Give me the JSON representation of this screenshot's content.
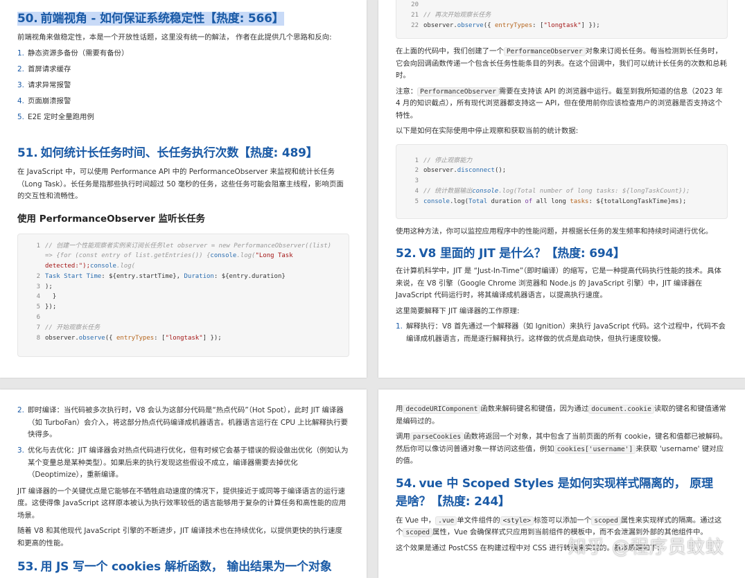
{
  "p1": {
    "q50_num": "50.",
    "q50_title": "前端视角 - 如何保证系统稳定性【热度: 566】",
    "q50_intro": "前端视角来做稳定性，本是一个开放性话题，这里没有统一的解法， 作者在此提供几个思路和反向:",
    "q50_items": [
      "静态资源多备份（需要有备份）",
      "首屏请求缓存",
      "请求异常报警",
      "页面崩溃报警",
      "E2E 定时全量跑用例"
    ],
    "q51_num": "51.",
    "q51_title": "如何统计长任务时间、长任务执行次数【热度: 489】",
    "q51_intro": "在 JavaScript 中，可以使用 Performance API 中的 PerformanceObserver 来监视和统计长任务（Long Task）。长任务是指那些执行时间超过 50 毫秒的任务，这些任务可能会阻塞主线程，影响页面的交互性和流畅性。",
    "q51_sub": "使用 PerformanceObserver 监听长任务",
    "code": {
      "l1a": "// 创建一个性能观察者实例来订阅长任务let observer = new PerformanceObserver((list)",
      "l1b": "=> {for (const entry of list.getEntries()) {",
      "l1b_fn": "console",
      "l1b_rest": ".log(",
      "l1b_str": "\"Long Task",
      "l1c_str": "detected:\");",
      "l1c_fn": "console",
      "l1c_rest": ".log(",
      "l2_a": "Task Start Time",
      "l2_b": ": ${entry.startTime}, ",
      "l2_c": "Duration",
      "l2_d": ": ${entry.duration}",
      "l3": ");",
      "l4": "  }",
      "l5": "});",
      "l6": "",
      "l7": "// 开始观察长任务",
      "l8_a": "observer.",
      "l8_fn": "observe",
      "l8_b": "({ ",
      "l8_key": "entryTypes",
      "l8_c": ": [",
      "l8_str": "\"longtask\"",
      "l8_d": "] });"
    }
  },
  "p2": {
    "code_top": {
      "l20": "",
      "l21": "// 再次开始观察长任务",
      "l22_a": "observer.",
      "l22_fn": "observe",
      "l22_b": "({ ",
      "l22_key": "entryTypes",
      "l22_c": ": [",
      "l22_str": "\"longtask\"",
      "l22_d": "] });"
    },
    "para1_a": "在上面的代码中，我们创建了一个",
    "para1_code": "PerformanceObserver",
    "para1_b": "对象来订阅长任务。每当检测到长任务时，它会向回调函数传递一个包含长任务性能条目的列表。在这个回调中，我们可以统计长任务的次数和总耗时。",
    "para2_a": "注意：",
    "para2_code": "PerformanceObserver",
    "para2_b": "需要在支持该 API 的浏览器中运行。截至到我所知道的信息（2023 年 4 月的知识截点），所有现代浏览器都支持这一 API，但在使用前你应该检查用户的浏览器是否支持这个特性。",
    "para3": "以下是如何在实际使用中停止观察和获取当前的统计数据:",
    "code2": {
      "l1": "// 停止观察能力",
      "l2_a": "observer.",
      "l2_fn": "disconnect",
      "l2_b": "();",
      "l3": "",
      "l4a": "// 统计数据输出",
      "l4b": "console",
      "l4c": ".log(Total number of long tasks: ${longTaskCount});",
      "l5_fn": "console",
      "l5_a": ".log(",
      "l5_b": "Total",
      "l5_c": " duration ",
      "l5_d": "of",
      "l5_e": " all long ",
      "l5_f": "tasks",
      "l5_g": ": ${totalLongTaskTime}ms);"
    },
    "para4": "使用这种方法，你可以监控应用程序中的性能问题，并根据长任务的发生频率和持续时间进行优化。",
    "q52_num": "52.",
    "q52_title": "V8 里面的 JIT 是什么？【热度: 694】",
    "q52_intro": "在计算机科学中，JIT 是 “Just-In-Time”（即时编译）的缩写，它是一种提高代码执行性能的技术。具体来说，在 V8 引擎（Google Chrome 浏览器和 Node.js 的 JavaScript 引擎）中，JIT 编译器在 JavaScript 代码运行时，将其编译成机器语言，以提高执行速度。",
    "q52_p2": "这里简要解释下 JIT 编译器的工作原理:",
    "q52_item1": "解释执行：V8 首先通过一个解释器（如 Ignition）来执行 JavaScript 代码。这个过程中，代码不会编译成机器语言，而是逐行解释执行。这样做的优点是启动快，但执行速度较慢。"
  },
  "p3": {
    "item2": "即时编译：当代码被多次执行时，V8 会认为这部分代码是“热点代码”（Hot Spot），此时 JIT 编译器（如 TurboFan）会介入，将这部分热点代码编译成机器语言。机器语言运行在 CPU 上比解释执行要快得多。",
    "item3": "优化与去优化：JIT 编译器会对热点代码进行优化，但有时候它会基于错误的假设做出优化（例如认为某个变量总是某种类型）。如果后来的执行发现这些假设不成立，编译器需要去掉优化（Deoptimize），重新编译。",
    "para1": "JIT 编译器的一个关键优点是它能够在不牺牲启动速度的情况下，提供接近于或同等于编译语言的运行速度。这使得像 JavaScript 这样原本被认为执行效率较低的语言能够用于复杂的计算任务和高性能的应用场景。",
    "para2": "随着 V8 和其他现代 JavaScript 引擎的不断进步，JIT 编译技术也在持续优化，以提供更快的执行速度和更高的性能。",
    "q53_num": "53.",
    "q53_title": "用 JS 写一个 cookies 解析函数， 输出结果为一个对象"
  },
  "p4": {
    "para1_a": "用",
    "para1_code1": "decodeURIComponent",
    "para1_b": "函数来解码键名和键值，因为通过",
    "para1_code2": "document.cookie",
    "para1_c": "读取的键名和键值通常是编码过的。",
    "para2_a": "调用",
    "para2_code1": "parseCookies",
    "para2_b": "函数将返回一个对象，其中包含了当前页面的所有 cookie，键名和值都已被解码。然后你可以像访问普通对象一样访问这些值，例如",
    "para2_code2": "cookies['username']",
    "para2_c": "来获取 'username' 键对应的值。",
    "q54_num": "54.",
    "q54_title": "vue 中 Scoped Styles 是如何实现样式隔离的， 原理是啥？【热度: 244】",
    "para3_a": "在 Vue 中，",
    "para3_code1": ".vue",
    "para3_b": "单文件组件的",
    "para3_code2": "<style>",
    "para3_c": "标签可以添加一个",
    "para3_code3": "scoped",
    "para3_d": "属性来实现样式的隔离。通过这个",
    "para3_code4": "scoped",
    "para3_e": "属性，Vue 会确保样式只应用到当前组件的模板中，而不会泄漏到外部的其他组件中。",
    "para4": "这个效果是通过 PostCSS 在构建过程中对 CSS 进行转换来实现的。基本原理如下:",
    "watermark": "知乎 @程序员蚊蚊"
  }
}
